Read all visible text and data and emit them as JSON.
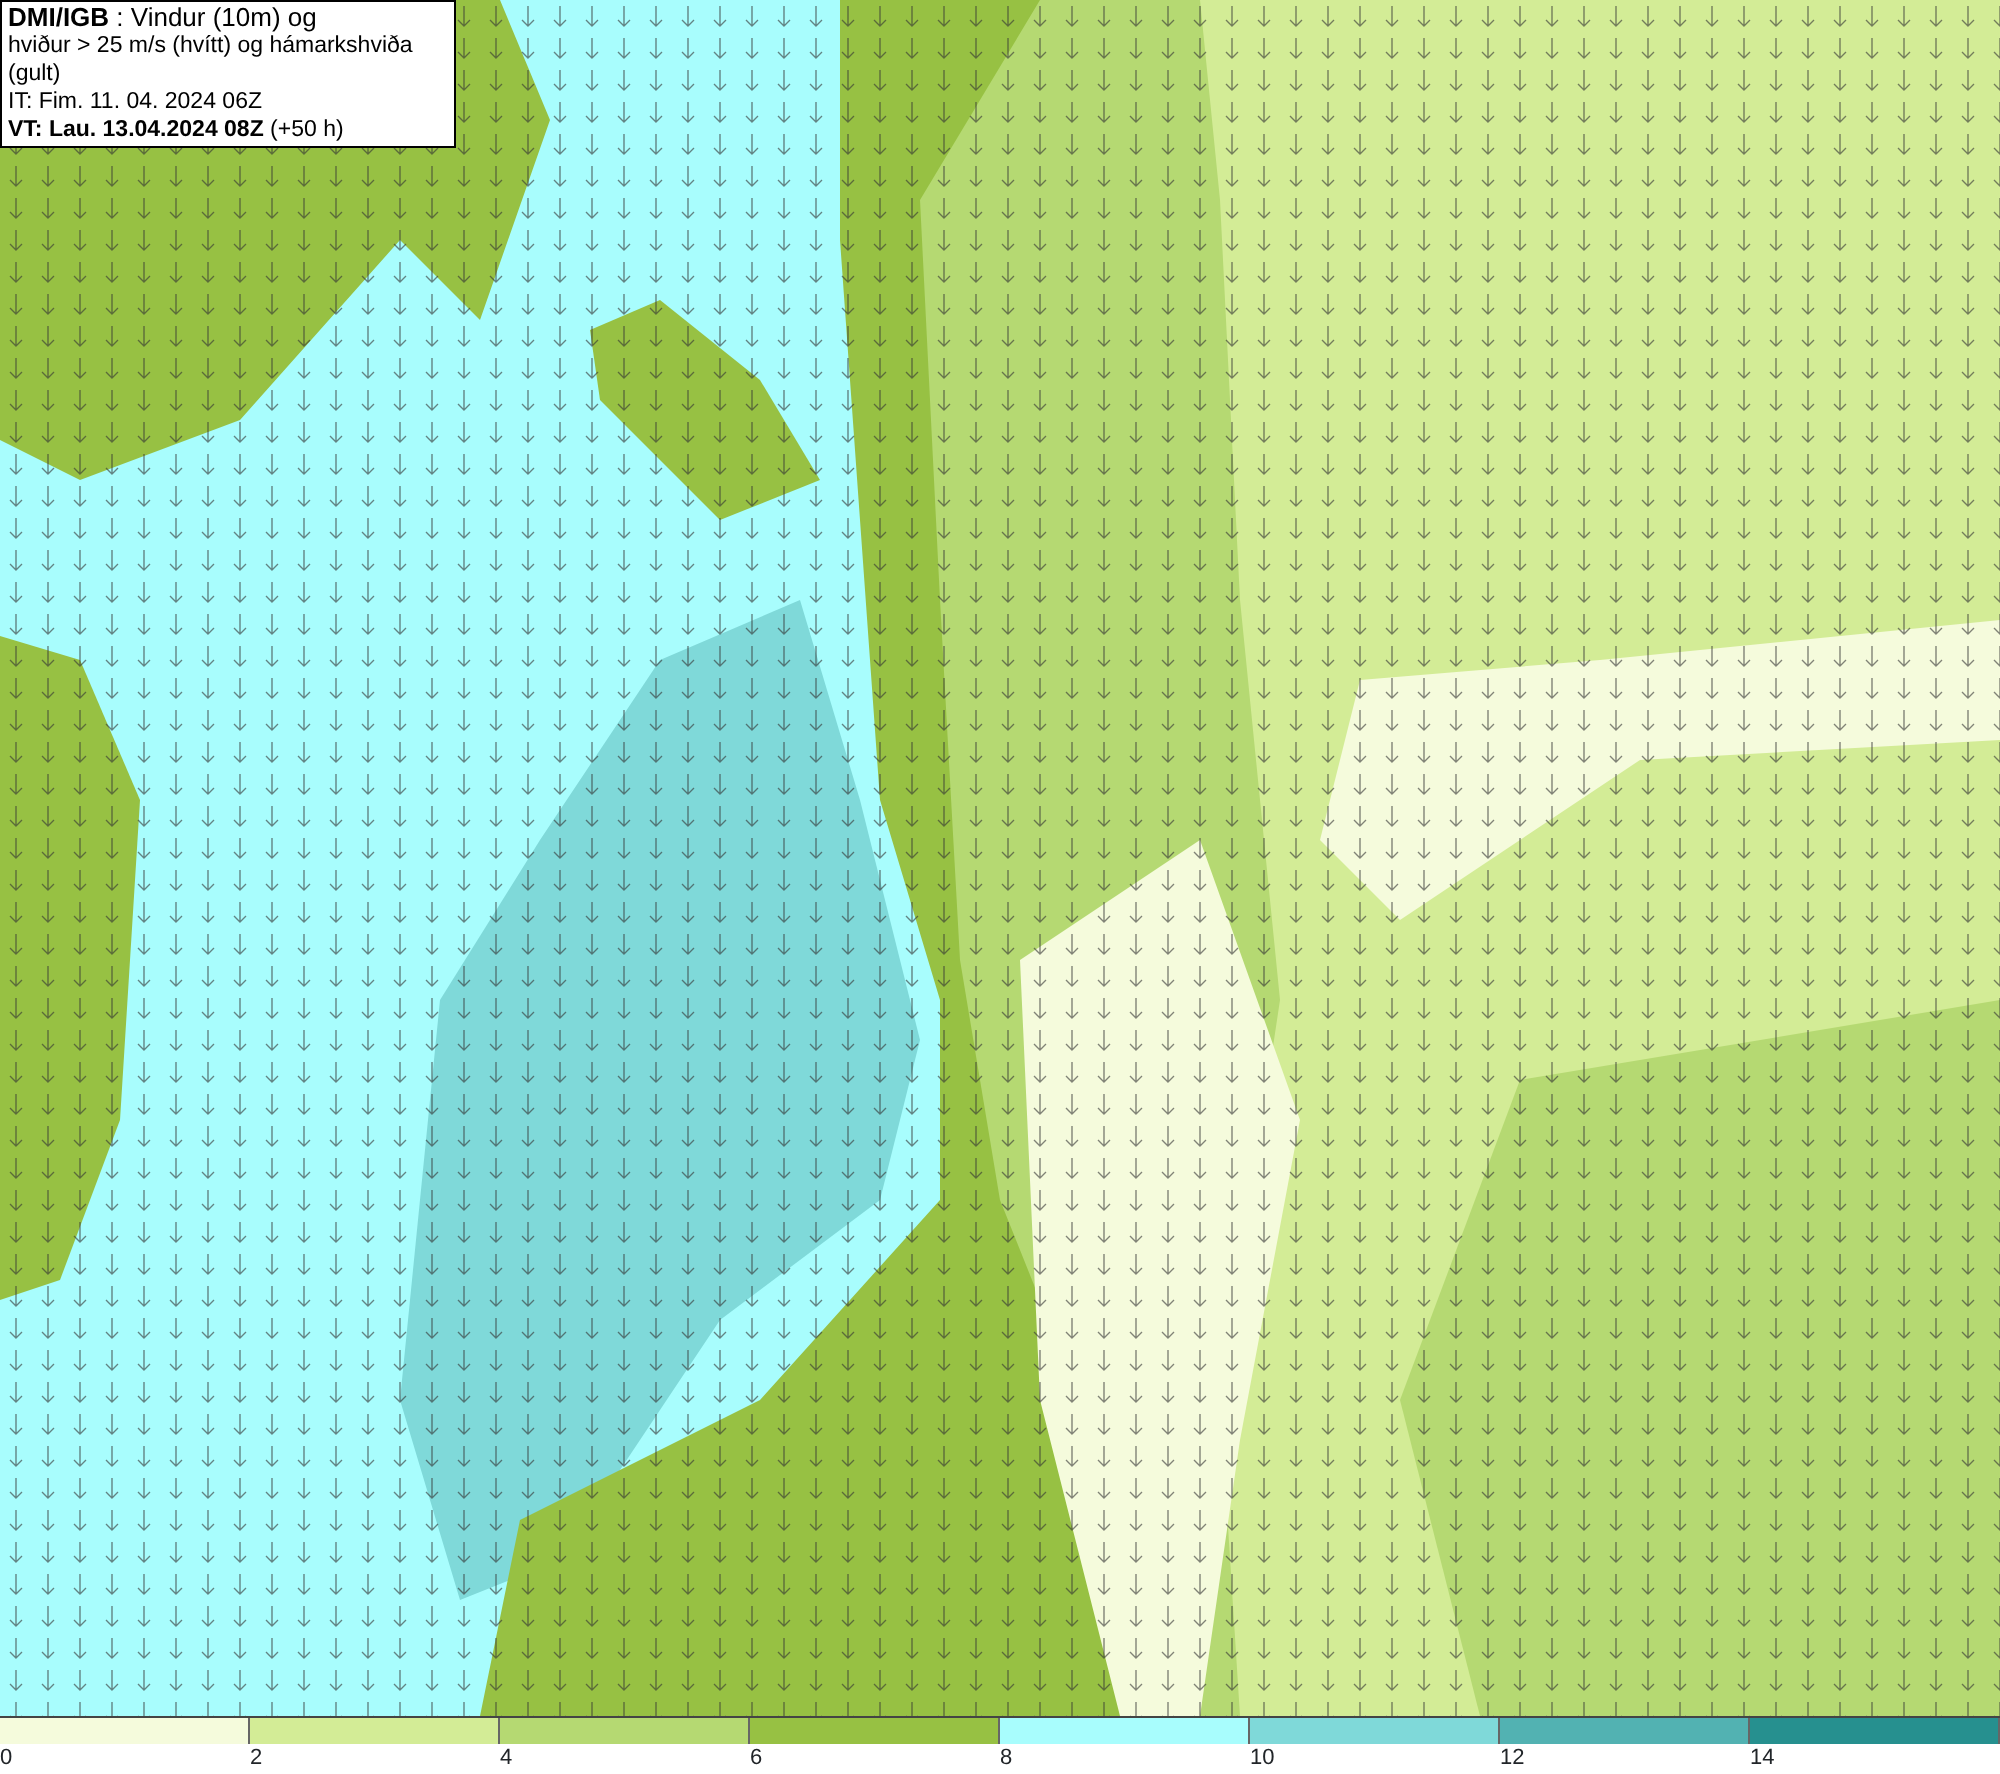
{
  "title_box": {
    "lines": [
      {
        "kind": "heading",
        "text": "**DMI/IGB** : Vindur (10m) og"
      },
      {
        "kind": "plain",
        "text": "hviður > 25 m/s (hvítt) og hámarkshviða (gult)"
      },
      {
        "kind": "plain",
        "text": "IT: Fim. 11. 04. 2024 06Z"
      },
      {
        "kind": "plain",
        "text": "**VT: Lau. 13.04.2024 08Z** (+50 h)"
      }
    ]
  },
  "legend": {
    "bins": [
      {
        "color": "#f5fbdc",
        "label": "0"
      },
      {
        "color": "#d3ec96",
        "label": "2"
      },
      {
        "color": "#b5d972",
        "label": "4"
      },
      {
        "color": "#97c143",
        "label": "6"
      },
      {
        "color": "#a8fdfd",
        "label": "8"
      },
      {
        "color": "#7fd9d9",
        "label": "10"
      },
      {
        "color": "#52b2b2",
        "label": "12"
      },
      {
        "color": "#26908f",
        "label": "14"
      }
    ]
  }
}
